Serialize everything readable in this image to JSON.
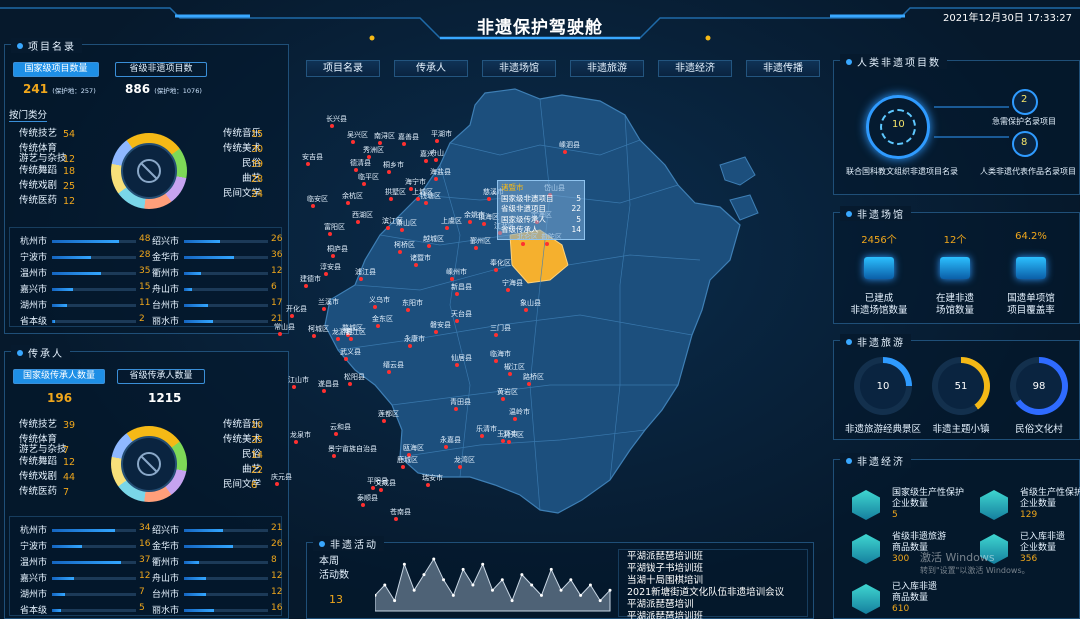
{
  "header": {
    "title": "非遗保护驾驶舱",
    "datetime": "2021年12月30日  17:33:27"
  },
  "nav": [
    "项目名录",
    "传承人",
    "非遗场馆",
    "非遗旅游",
    "非遗经济",
    "非遗传播"
  ],
  "project": {
    "title": "项目名录",
    "tab_national": "国家级项目数量",
    "tab_provincial": "省级非遗项目数",
    "national_count": "241",
    "national_protect": "(保护地：257)",
    "provincial_count": "886",
    "provincial_protect": "(保护地：1076)",
    "category_label": "按门类分",
    "left": [
      {
        "n": "传统技艺",
        "v": "54"
      },
      {
        "n": "传统体育\n游艺与杂技",
        "v": "12"
      },
      {
        "n": "传统舞蹈",
        "v": "18"
      },
      {
        "n": "传统戏剧",
        "v": "25"
      },
      {
        "n": "传统医药",
        "v": "12"
      }
    ],
    "right": [
      {
        "n": "传统音乐",
        "v": "15"
      },
      {
        "n": "传统美术",
        "v": "30"
      },
      {
        "n": "民俗",
        "v": "39"
      },
      {
        "n": "曲艺",
        "v": "28"
      },
      {
        "n": "民间文学",
        "v": "24"
      }
    ],
    "cities_l": [
      {
        "n": "杭州市",
        "v": "48"
      },
      {
        "n": "宁波市",
        "v": "28"
      },
      {
        "n": "温州市",
        "v": "35"
      },
      {
        "n": "嘉兴市",
        "v": "15"
      },
      {
        "n": "湖州市",
        "v": "11"
      },
      {
        "n": "省本级",
        "v": "2"
      }
    ],
    "cities_r": [
      {
        "n": "绍兴市",
        "v": "26"
      },
      {
        "n": "金华市",
        "v": "36"
      },
      {
        "n": "衢州市",
        "v": "12"
      },
      {
        "n": "舟山市",
        "v": "6"
      },
      {
        "n": "台州市",
        "v": "17"
      },
      {
        "n": "丽水市",
        "v": "21"
      }
    ]
  },
  "inheritor": {
    "title": "传承人",
    "tab_national": "国家级传承人数量",
    "tab_provincial": "省级传承人数量",
    "national_count": "196",
    "provincial_count": "1215",
    "left": [
      {
        "n": "传统技艺",
        "v": "39"
      },
      {
        "n": "传统体育\n游艺与杂技",
        "v": "7"
      },
      {
        "n": "传统舞蹈",
        "v": "12"
      },
      {
        "n": "传统戏剧",
        "v": "44"
      },
      {
        "n": "传统医药",
        "v": "7"
      }
    ],
    "right": [
      {
        "n": "传统音乐",
        "v": "10"
      },
      {
        "n": "传统美术",
        "v": "35"
      },
      {
        "n": "民俗",
        "v": "14"
      },
      {
        "n": "曲艺",
        "v": "22"
      },
      {
        "n": "民间文学",
        "v": "6"
      }
    ],
    "cities_l": [
      {
        "n": "杭州市",
        "v": "34"
      },
      {
        "n": "宁波市",
        "v": "16"
      },
      {
        "n": "温州市",
        "v": "37"
      },
      {
        "n": "嘉兴市",
        "v": "12"
      },
      {
        "n": "湖州市",
        "v": "7"
      },
      {
        "n": "省本级",
        "v": "5"
      }
    ],
    "cities_r": [
      {
        "n": "绍兴市",
        "v": "21"
      },
      {
        "n": "金华市",
        "v": "26"
      },
      {
        "n": "衢州市",
        "v": "8"
      },
      {
        "n": "舟山市",
        "v": "12"
      },
      {
        "n": "台州市",
        "v": "12"
      },
      {
        "n": "丽水市",
        "v": "16"
      }
    ]
  },
  "tooltip": {
    "title": "诸暨市",
    "rows": [
      {
        "k": "国家级非遗项目",
        "v": "5"
      },
      {
        "k": "省级非遗项目",
        "v": "22"
      },
      {
        "k": "国家级传承人",
        "v": "5"
      },
      {
        "k": "省级传承人",
        "v": "14"
      }
    ]
  },
  "map_labels": [
    "长兴县",
    "吴兴区",
    "南浔区",
    "秀洲区",
    "嘉善县",
    "平湖市",
    "嘉兴",
    "海盐县",
    "桐乡市",
    "德清县",
    "海宁市",
    "安吉县",
    "临平区",
    "余杭区",
    "上城区",
    "拱墅区",
    "钱塘区",
    "上虞区",
    "余姚市",
    "慈溪市",
    "镇海区",
    "江北区",
    "北仑区",
    "鄞州区",
    "奉化区",
    "宁海县",
    "象山县",
    "定海区",
    "普陀区",
    "岱山县",
    "嵊泗县",
    "临安区",
    "西湖区",
    "滨江区",
    "萧山区",
    "柯桥区",
    "越城区",
    "诸暨市",
    "嵊州市",
    "新昌县",
    "天台县",
    "三门县",
    "临海市",
    "椒江区",
    "黄岩区",
    "路桥区",
    "温岭市",
    "玉环市",
    "淳安县",
    "建德市",
    "桐庐县",
    "富阳区",
    "浦江县",
    "义乌市",
    "东阳市",
    "磐安县",
    "兰溪市",
    "金东区",
    "婺城区",
    "武义县",
    "永康市",
    "缙云县",
    "仙居县",
    "开化县",
    "常山县",
    "柯城区",
    "衢江区",
    "龙游县",
    "江山市",
    "遂昌县",
    "松阳县",
    "莲都区",
    "青田县",
    "永嘉县",
    "乐清市",
    "瓯海区",
    "龙湾区",
    "鹿城区",
    "瑞安市",
    "平阳县",
    "苍南县",
    "文成县",
    "泰顺县",
    "景宁畲族自治县",
    "云和县",
    "龙泉市",
    "庆元县",
    "洞头区",
    "舟山"
  ],
  "activity": {
    "title": "非遗活动",
    "label": "本周\n活动数",
    "count": "13",
    "points": [
      3,
      5,
      2,
      9,
      4,
      7,
      10,
      6,
      3,
      8,
      5,
      9,
      4,
      6,
      2,
      7,
      5,
      3,
      8,
      4,
      6,
      3,
      5,
      2,
      4
    ],
    "items": [
      "平湖派琵琶培训班",
      "平湖钹子书培训班",
      "当湖十局围棋培训",
      "2021新塘街道文化队伍非遗培训会议",
      "平湖派琵琶培训",
      "平湖派琵琶培训班"
    ]
  },
  "human": {
    "title": "人类非遗项目数",
    "core": "10",
    "core_label": "联合国科教文组织非遗项目名录",
    "a_num": "2",
    "a_label": "急需保护名录项目",
    "b_num": "8",
    "b_label": "人类非遗代表作品名录项目"
  },
  "venue": {
    "title": "非遗场馆",
    "items": [
      {
        "num": "2456个",
        "cap": "已建成\n非遗场馆数量"
      },
      {
        "num": "12个",
        "cap": "在建非遗\n场馆数量"
      },
      {
        "num": "64.2%",
        "cap": "国遗单项馆\n项目覆盖率"
      }
    ]
  },
  "tourism": {
    "title": "非遗旅游",
    "items": [
      {
        "num": "10",
        "cap": "非遗旅游经典景区",
        "pct": 0.25,
        "color": "#2f9bff"
      },
      {
        "num": "51",
        "cap": "非遗主题小镇",
        "pct": 0.4,
        "color": "#f5b916"
      },
      {
        "num": "98",
        "cap": "民俗文化村",
        "pct": 0.65,
        "color": "#2f6bff"
      }
    ]
  },
  "economy": {
    "title": "非遗经济",
    "items": [
      {
        "cap": "国家级生产性保护\n企业数量",
        "v": "5"
      },
      {
        "cap": "省级生产性保护\n企业数量",
        "v": "129"
      },
      {
        "cap": "省级非遗旅游\n商品数量",
        "v": "300"
      },
      {
        "cap": "已入库非遗\n企业数量",
        "v": "356"
      },
      {
        "cap": "已入库非遗\n商品数量",
        "v": "610"
      }
    ]
  },
  "watermark": {
    "line1": "激活 Windows",
    "line2": "转到\"设置\"以激活 Windows。"
  }
}
